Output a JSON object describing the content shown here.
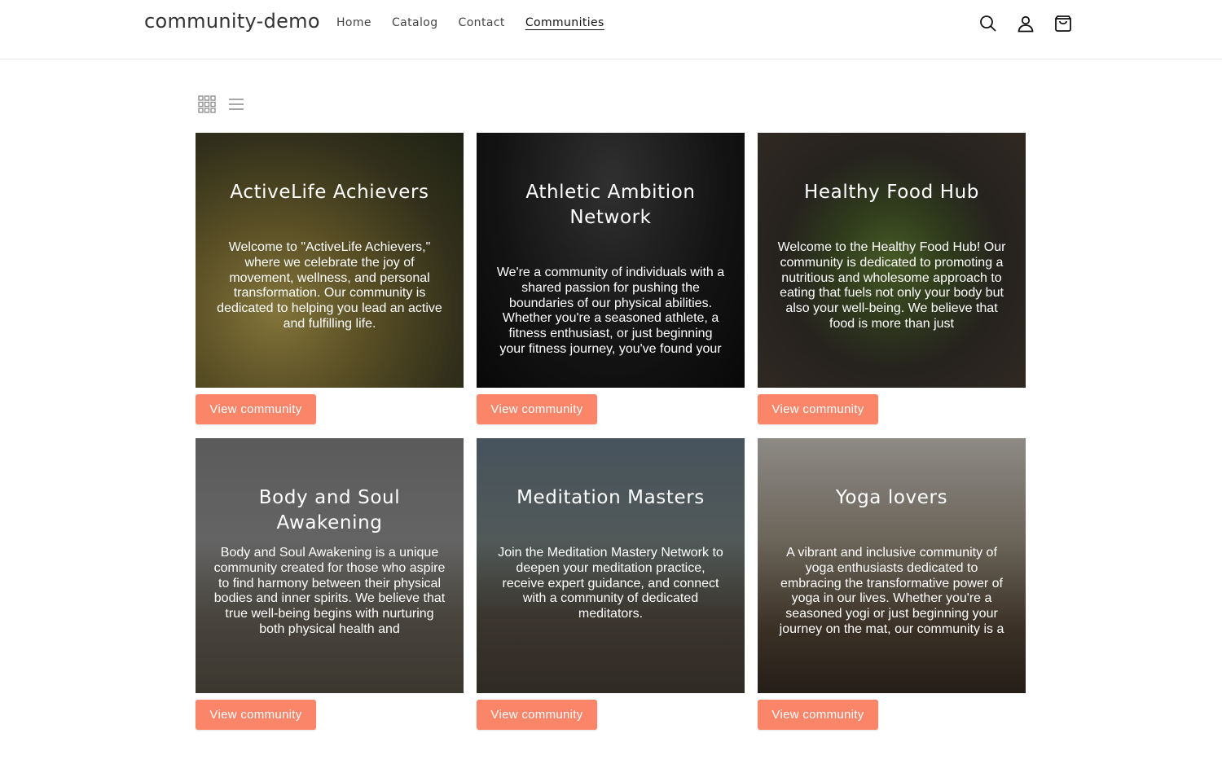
{
  "header": {
    "brand": "community-demo",
    "nav": [
      {
        "label": "Home",
        "active": false
      },
      {
        "label": "Catalog",
        "active": false
      },
      {
        "label": "Contact",
        "active": false
      },
      {
        "label": "Communities",
        "active": true
      }
    ],
    "icons": [
      "search-icon",
      "account-icon",
      "cart-icon"
    ]
  },
  "view_toggles": [
    "grid-view-icon",
    "list-view-icon"
  ],
  "accent_color": "#fa8569",
  "communities": [
    {
      "title": "ActiveLife Achievers",
      "description": "Welcome to \"ActiveLife Achievers,\" where we celebrate the joy of movement, wellness, and personal transformation. Our community is dedicated to helping you lead an active and fulfilling life.",
      "button": "View community"
    },
    {
      "title": "Athletic Ambition Network",
      "description": "We're a community of individuals with a shared passion for pushing the boundaries of our physical abilities. Whether you're a seasoned athlete, a fitness enthusiast, or just beginning your fitness journey, you've found your",
      "button": "View community"
    },
    {
      "title": "Healthy Food Hub",
      "description": "Welcome to the Healthy Food Hub! Our community is dedicated to promoting a nutritious and wholesome approach to eating that fuels not only your body but also your well-being. We believe that food is more than just",
      "button": "View community"
    },
    {
      "title": "Body and Soul Awakening",
      "description": "Body and Soul Awakening is a unique community created for those who aspire to find harmony between their physical bodies and inner spirits. We believe that true well-being begins with nurturing both physical health and",
      "button": "View community"
    },
    {
      "title": "Meditation Masters",
      "description": "Join the Meditation Mastery Network to deepen your meditation practice, receive expert guidance, and connect with a community of dedicated meditators.",
      "button": "View community"
    },
    {
      "title": "Yoga lovers",
      "description": "A vibrant and inclusive community of yoga enthusiasts dedicated to embracing the transformative power of yoga in our lives. Whether you're a seasoned yogi or just beginning your journey on the mat, our community is a",
      "button": "View community"
    }
  ]
}
